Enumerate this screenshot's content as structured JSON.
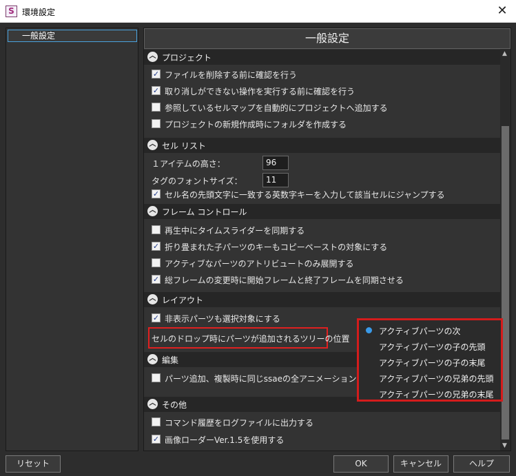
{
  "window": {
    "title": "環境設定",
    "app_icon_letter": "S",
    "close_glyph": "✕"
  },
  "tree": {
    "items": [
      {
        "label": "一般設定"
      }
    ]
  },
  "panel": {
    "title": "一般設定"
  },
  "sections": {
    "project": {
      "title": "プロジェクト",
      "items": [
        {
          "label": "ファイルを削除する前に確認を行う",
          "checked": true
        },
        {
          "label": "取り消しができない操作を実行する前に確認を行う",
          "checked": true
        },
        {
          "label": "参照しているセルマップを自動的にプロジェクトへ追加する",
          "checked": false
        },
        {
          "label": "プロジェクトの新規作成時にフォルダを作成する",
          "checked": false
        }
      ]
    },
    "cell_list": {
      "title": "セル リスト",
      "item_height_label": "１アイテムの高さ：",
      "item_height_value": "96",
      "tag_font_size_label": "タグのフォントサイズ：",
      "tag_font_size_value": "11",
      "items": [
        {
          "label": "セル名の先頭文字に一致する英数字キーを入力して該当セルにジャンプする",
          "checked": true
        }
      ]
    },
    "frame_control": {
      "title": "フレーム コントロール",
      "items": [
        {
          "label": "再生中にタイムスライダーを同期する",
          "checked": false
        },
        {
          "label": "折り畳まれた子パーツのキーもコピーペーストの対象にする",
          "checked": true
        },
        {
          "label": "アクティブなパーツのアトリビュートのみ展開する",
          "checked": false
        },
        {
          "label": "総フレームの変更時に開始フレームと終了フレームを同期させる",
          "checked": true
        }
      ]
    },
    "layout": {
      "title": "レイアウト",
      "items": [
        {
          "label": "非表示パーツも選択対象にする",
          "checked": true
        }
      ],
      "drop_position_label": "セルのドロップ時にパーツが追加されるツリーの位置"
    },
    "edit": {
      "title": "編集",
      "items": [
        {
          "label": "パーツ追加、複製時に同じssaeの全アニメーションデータにキー",
          "checked": false
        }
      ]
    },
    "other": {
      "title": "その他",
      "items": [
        {
          "label": "コマンド履歴をログファイルに出力する",
          "checked": false
        },
        {
          "label": "画像ローダーVer.1.5を使用する",
          "checked": true
        }
      ]
    }
  },
  "dropdown": {
    "selected_index": 0,
    "options": [
      "アクティブパーツの次",
      "アクティブパーツの子の先頭",
      "アクティブパーツの子の末尾",
      "アクティブパーツの兄弟の先頭",
      "アクティブパーツの兄弟の末尾"
    ],
    "selected_color": "#3a9ae8"
  },
  "buttons": {
    "reset": "リセット",
    "ok": "OK",
    "cancel": "キャンセル",
    "help": "ヘルプ"
  },
  "colors": {
    "highlight": "#e02020",
    "background": "#2d2d2d",
    "section_header": "#262626"
  }
}
